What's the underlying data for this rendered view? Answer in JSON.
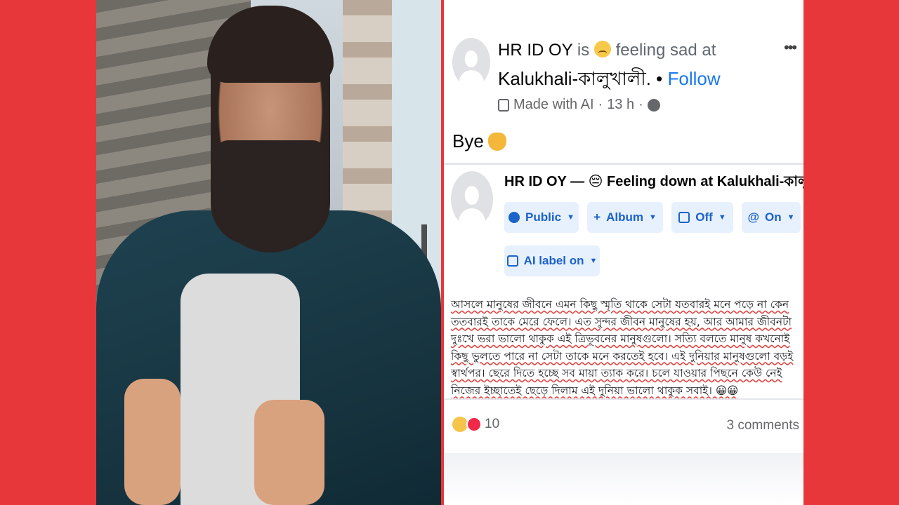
{
  "post": {
    "author": "HR ID OY",
    "feeling_prefix": "is",
    "feeling": "feeling sad at",
    "location": "Kalukhali-কালুখালী.",
    "separator": "•",
    "follow_label": "Follow",
    "made_with_ai": "Made with AI",
    "time": "13 h",
    "dot": "·",
    "more_label": "•••",
    "message": "Bye",
    "composer": {
      "line": "HR ID OY — 😔 Feeling down at Kalukhali-কালুখালী.",
      "buttons": [
        {
          "label": "Public",
          "icon": "globe-icon"
        },
        {
          "label": "Album",
          "icon": "plus-icon"
        },
        {
          "label": "Off",
          "icon": "instagram-icon"
        },
        {
          "label": "On",
          "icon": "threads-icon"
        },
        {
          "label": "AI label on",
          "icon": "ai-label-icon"
        }
      ],
      "text": "আসলে মানুষের জীবনে এমন কিছু স্মৃতি থাকে সেটা যতবারই মনে পড়ে না কেন ততবারই তাকে মেরে ফেলে। এত সুন্দর জীবন মানুষের হয়, আর আমার জীবনটা দুঃখে ভরা ভালো থাকুক এই ত্রিভূবনের মানুষগুলো। সত্যি বলতে মানুষ কখনোই কিছু ভুলতে পারে না সেটা তাকে মনে করতেই হবে। এই দুনিয়ার মানুষগুলো বড়ই স্বার্থপর। ছেরে দিতে হচ্ছে সব মায়া ত্যাক করে। চলে যাওয়ার পিছনে কেউ নেই নিজের ইচ্ছাতেই ছেড়ে দিলাম এই দুনিয়া ভালো থাকুক সবাই। 😀😀"
    },
    "reaction_count": "10",
    "comments": "3 comments"
  },
  "colors": {
    "background": "#e8373a",
    "link": "#1877f2",
    "pill_bg": "#e7f0fd",
    "pill_text": "#1b62c9"
  }
}
